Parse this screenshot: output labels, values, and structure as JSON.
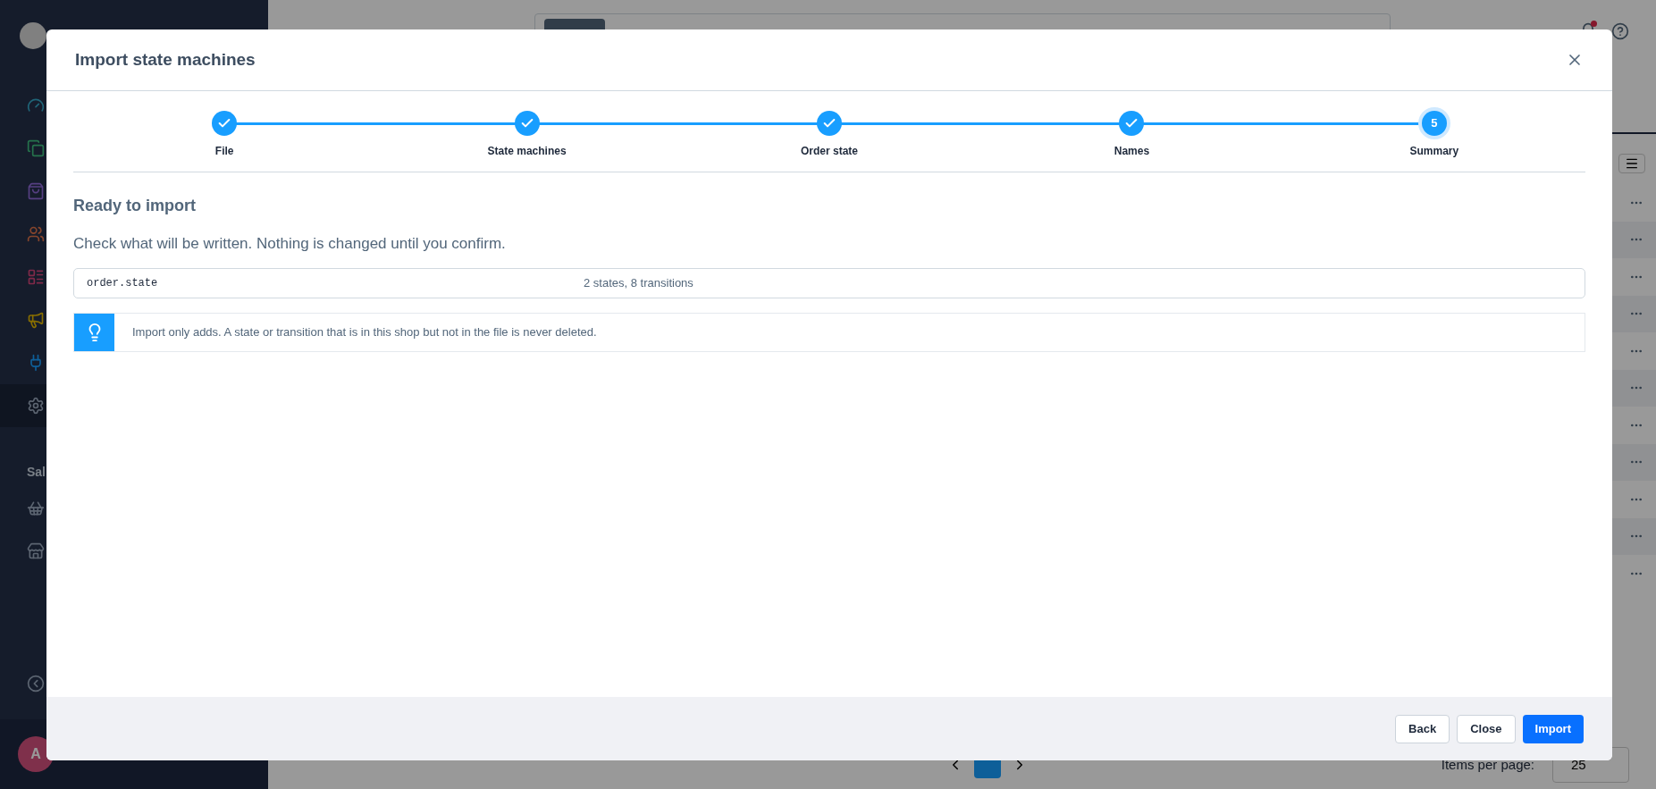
{
  "sidebar": {
    "section_heading": "Sal",
    "user": {
      "initial": "A"
    }
  },
  "pagination": {
    "pages": [
      {
        "selected": true
      }
    ],
    "items_per_page_label": "Items per page:",
    "items_per_page": "25"
  },
  "dialog": {
    "title": "Import state machines",
    "steps": [
      {
        "label": "File",
        "kind": "done"
      },
      {
        "label": "State machines",
        "kind": "done"
      },
      {
        "label": "Order state",
        "kind": "done"
      },
      {
        "label": "Names",
        "kind": "done"
      },
      {
        "label": "Summary",
        "kind": "current",
        "number": "5"
      }
    ],
    "heading": "Ready to import",
    "intro": "Check what will be written. Nothing is changed until you confirm.",
    "machines": [
      {
        "name": "order.state",
        "summary": "2 states, 8 transitions"
      }
    ],
    "tip": "Import only adds. A state or transition that is in this shop but not in the file is never deleted.",
    "buttons": [
      {
        "label": "Back",
        "kind": "secondary"
      },
      {
        "label": "Close",
        "kind": "secondary"
      },
      {
        "label": "Import",
        "kind": "primary"
      }
    ]
  }
}
